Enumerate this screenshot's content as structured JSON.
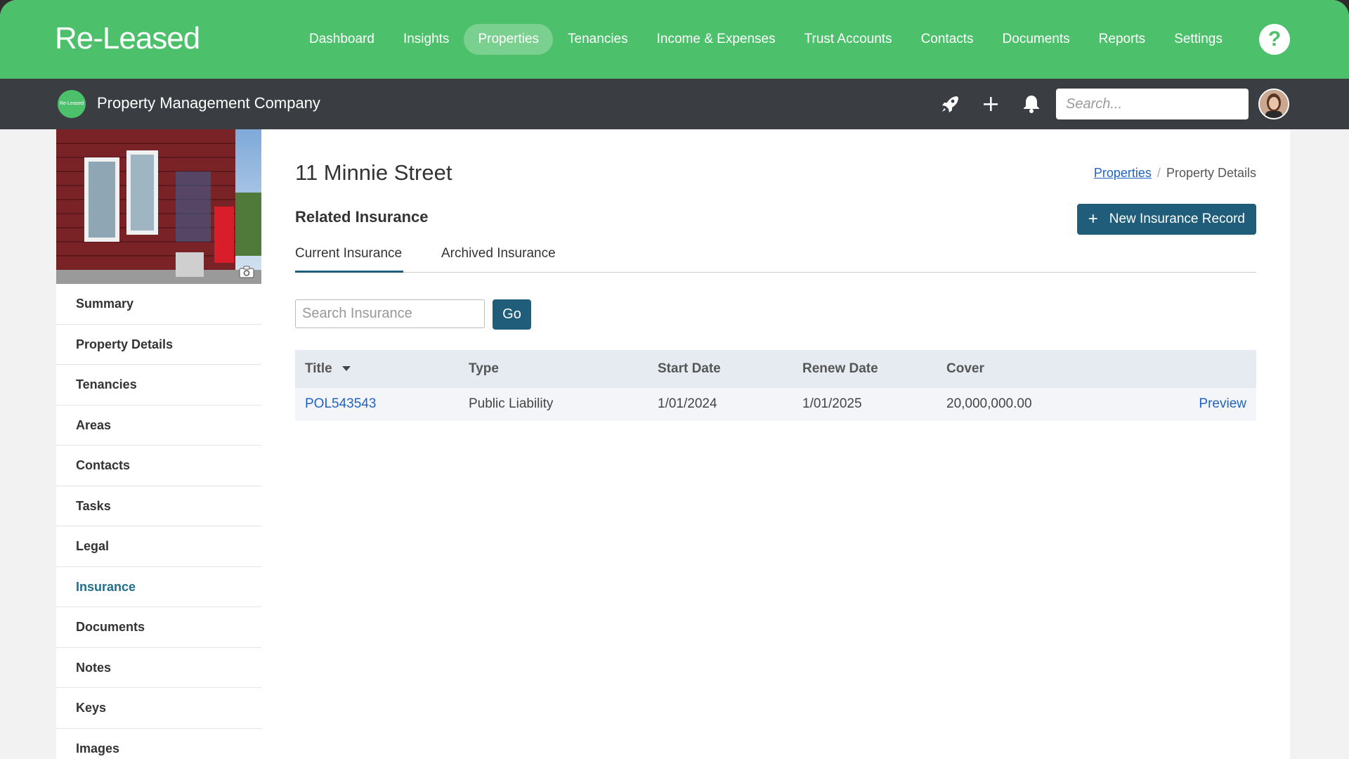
{
  "app": {
    "logo": "Re-Leased"
  },
  "nav": {
    "items": [
      {
        "label": "Dashboard"
      },
      {
        "label": "Insights"
      },
      {
        "label": "Properties"
      },
      {
        "label": "Tenancies"
      },
      {
        "label": "Income & Expenses"
      },
      {
        "label": "Trust Accounts"
      },
      {
        "label": "Contacts"
      },
      {
        "label": "Documents"
      },
      {
        "label": "Reports"
      },
      {
        "label": "Settings"
      }
    ],
    "active": "Properties",
    "help_label": "?"
  },
  "subheader": {
    "company_logo_text": "Re-Leased",
    "company_name": "Property Management Company",
    "search_placeholder": "Search..."
  },
  "sidebar": {
    "items": [
      {
        "label": "Summary"
      },
      {
        "label": "Property Details"
      },
      {
        "label": "Tenancies"
      },
      {
        "label": "Areas"
      },
      {
        "label": "Contacts"
      },
      {
        "label": "Tasks"
      },
      {
        "label": "Legal"
      },
      {
        "label": "Insurance"
      },
      {
        "label": "Documents"
      },
      {
        "label": "Notes"
      },
      {
        "label": "Keys"
      },
      {
        "label": "Images"
      }
    ],
    "active": "Insurance"
  },
  "page": {
    "title": "11 Minnie Street",
    "breadcrumb": {
      "link": "Properties",
      "separator": "/",
      "current": "Property Details"
    },
    "section_title": "Related Insurance",
    "new_button": {
      "icon": "+",
      "label": "New Insurance Record"
    },
    "tabs": [
      {
        "label": "Current Insurance"
      },
      {
        "label": "Archived Insurance"
      }
    ],
    "active_tab": "Current Insurance",
    "search_placeholder": "Search Insurance",
    "go_label": "Go"
  },
  "table": {
    "columns": [
      "Title",
      "Type",
      "Start Date",
      "Renew Date",
      "Cover"
    ],
    "rows": [
      {
        "title": "POL543543",
        "type": "Public Liability",
        "start": "1/01/2024",
        "renew": "1/01/2025",
        "cover": "20,000,000.00",
        "action": "Preview"
      }
    ]
  },
  "colors": {
    "brand_green": "#4cc06a",
    "dark_bar": "#3a3d42",
    "primary_button": "#205d7a",
    "link": "#1f63c0"
  }
}
